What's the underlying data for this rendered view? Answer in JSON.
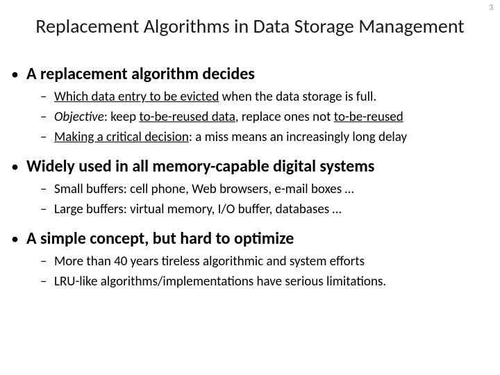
{
  "page_number": "3",
  "title": "Replacement Algorithms in Data Storage Management",
  "bullets": [
    {
      "text": "A replacement algorithm decides",
      "sub": [
        {
          "lead_ul": "Which data entry to be evicted",
          "rest": " when the data storage is full."
        },
        {
          "italic_lead": "Objective",
          "rest1": ": keep ",
          "ul1": "to-be-reused data",
          "rest2": ", replace ones not ",
          "ul2": "to-be-reused"
        },
        {
          "lead_ul": "Making a critical decision",
          "rest": ": a miss means an increasingly long delay"
        }
      ]
    },
    {
      "text": "Widely used in all memory-capable digital systems",
      "sub": [
        {
          "plain1": "Small buffers",
          "rest": ": cell phone, Web browsers, e-mail boxes …"
        },
        {
          "plain1": "Large buffers",
          "rest": ":  virtual memory, I/O buffer, databases …"
        }
      ]
    },
    {
      "text": "A simple concept, but hard to optimize",
      "sub": [
        {
          "plain": "More than 40 years tireless algorithmic and system efforts"
        },
        {
          "plain": "LRU-like algorithms/implementations have serious limitations."
        }
      ]
    }
  ],
  "glyphs": {
    "l1": "•",
    "l2": "–"
  }
}
